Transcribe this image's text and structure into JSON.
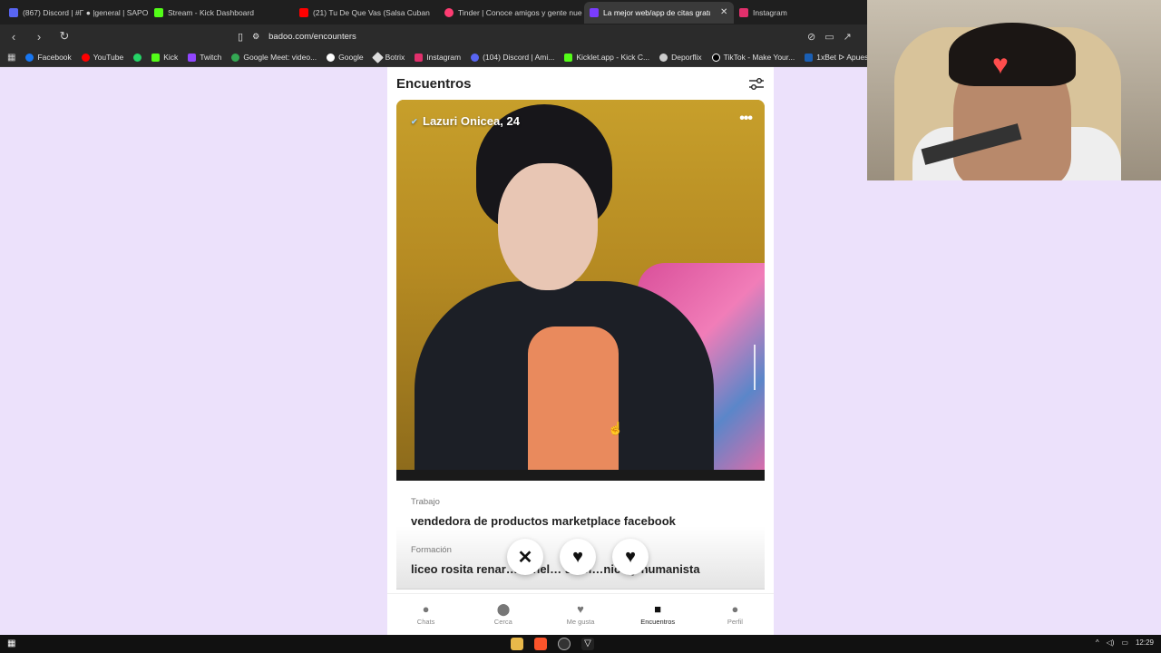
{
  "browser": {
    "tabs": [
      {
        "label": "(867) Discord | #Γ ● |general | SAPO",
        "icon": "discord-icon",
        "color": "#5865f2",
        "active": false
      },
      {
        "label": "Stream - Kick Dashboard",
        "icon": "kick-icon",
        "color": "#53fc18",
        "active": false
      },
      {
        "label": "(21) Tu De Que Vas (Salsa Cuban",
        "icon": "youtube-icon",
        "color": "#ff0000",
        "active": false
      },
      {
        "label": "Tinder | Conoce amigos y gente nue",
        "icon": "tinder-icon",
        "color": "#fe3c72",
        "active": false
      },
      {
        "label": "La mejor web/app de citas gratu",
        "icon": "badoo-icon",
        "color": "#7a3cff",
        "active": true
      },
      {
        "label": "Instagram",
        "icon": "instagram-icon",
        "color": "#e1306c",
        "active": false
      }
    ],
    "url": "badoo.com/encounters",
    "bookmarks": [
      {
        "label": "Facebook",
        "color": "#1877f2"
      },
      {
        "label": "YouTube",
        "color": "#ff0000"
      },
      {
        "label": "",
        "color": "#25d366"
      },
      {
        "label": "Kick",
        "color": "#53fc18"
      },
      {
        "label": "Twitch",
        "color": "#9146ff"
      },
      {
        "label": "Google Meet: video...",
        "color": "#34a853"
      },
      {
        "label": "Google",
        "color": "#ffffff"
      },
      {
        "label": "Botrix",
        "color": "#dddddd"
      },
      {
        "label": "Instagram",
        "color": "#e1306c"
      },
      {
        "label": "(104) Discord | Ami...",
        "color": "#5865f2"
      },
      {
        "label": "Kicklet.app - Kick C...",
        "color": "#53fc18"
      },
      {
        "label": "Deporflix",
        "color": "#cccccc"
      },
      {
        "label": "TikTok - Make Your...",
        "color": "#000000"
      },
      {
        "label": "1xBet ᐅ Apues",
        "color": "#1a5fb4"
      }
    ]
  },
  "app": {
    "header_title": "Encuentros",
    "profile": {
      "name": "Lazuri Onicea, 24"
    },
    "work_label": "Trabajo",
    "work_value": "vendedora de productos marketplace facebook",
    "education_label": "Formación",
    "education_value": "liceo rosita renar… ronel… so ci…nico y humanista"
  },
  "nav": [
    {
      "label": "Chats",
      "icon": "chat-icon",
      "glyph": "●",
      "active": false
    },
    {
      "label": "Cerca",
      "icon": "location-pin-icon",
      "glyph": "▼",
      "active": false
    },
    {
      "label": "Me gusta",
      "icon": "heart-icon",
      "glyph": "♥",
      "active": false
    },
    {
      "label": "Encuentros",
      "icon": "cards-icon",
      "glyph": "■",
      "active": true
    },
    {
      "label": "Perfil",
      "icon": "person-icon",
      "glyph": "●",
      "active": false
    }
  ],
  "taskbar": {
    "time": "12:29"
  },
  "colors": {
    "page_bg": "#ece1fb",
    "accent": "#7a3cff"
  }
}
